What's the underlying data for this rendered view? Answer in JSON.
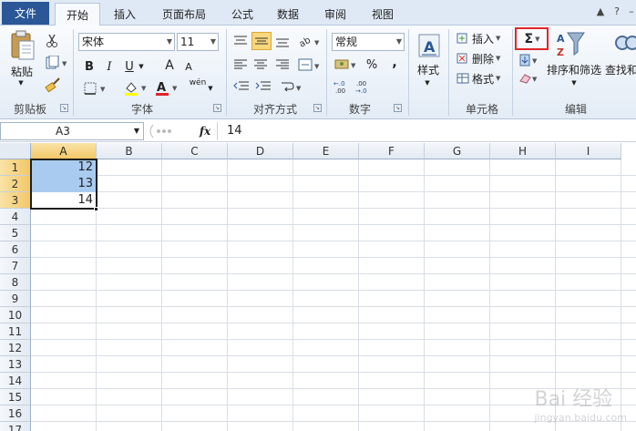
{
  "tabs": {
    "file": "文件",
    "home": "开始",
    "insert": "插入",
    "page_layout": "页面布局",
    "formulas": "公式",
    "data": "数据",
    "review": "审阅",
    "view": "视图"
  },
  "ribbon": {
    "clipboard": {
      "paste": "粘贴",
      "label": "剪贴板"
    },
    "font": {
      "name": "宋体",
      "size": "11",
      "bold": "B",
      "italic": "I",
      "underline": "U",
      "grow": "A",
      "shrink": "A",
      "wen": "wén",
      "label": "字体"
    },
    "alignment": {
      "label": "对齐方式"
    },
    "number": {
      "format": "常规",
      "percent": "%",
      "comma": ",",
      "label": "数字"
    },
    "styles": {
      "label": "样式"
    },
    "cells": {
      "insert": "插入",
      "delete": "删除",
      "format": "格式",
      "label": "单元格"
    },
    "editing": {
      "autosum": "Σ",
      "sort_filter": "排序和筛选",
      "find_select": "查找和",
      "label": "编辑"
    }
  },
  "formula_bar": {
    "name_box": "A3",
    "fx": "fx",
    "content": "14"
  },
  "sheet": {
    "columns": [
      "A",
      "B",
      "C",
      "D",
      "E",
      "F",
      "G",
      "H",
      "I"
    ],
    "rows": [
      "1",
      "2",
      "3",
      "4",
      "5",
      "6",
      "7",
      "8",
      "9",
      "10",
      "11",
      "12",
      "13",
      "14",
      "15",
      "16",
      "17"
    ],
    "cells": {
      "A1": "12",
      "A2": "13",
      "A3": "14"
    }
  },
  "watermark": {
    "main": "Bai 经验",
    "sub": "jingyan.baidu.com"
  },
  "colors": {
    "file_tab": "#2b5797",
    "selection": "#a9cbef",
    "highlight_box": "#e0262a"
  }
}
